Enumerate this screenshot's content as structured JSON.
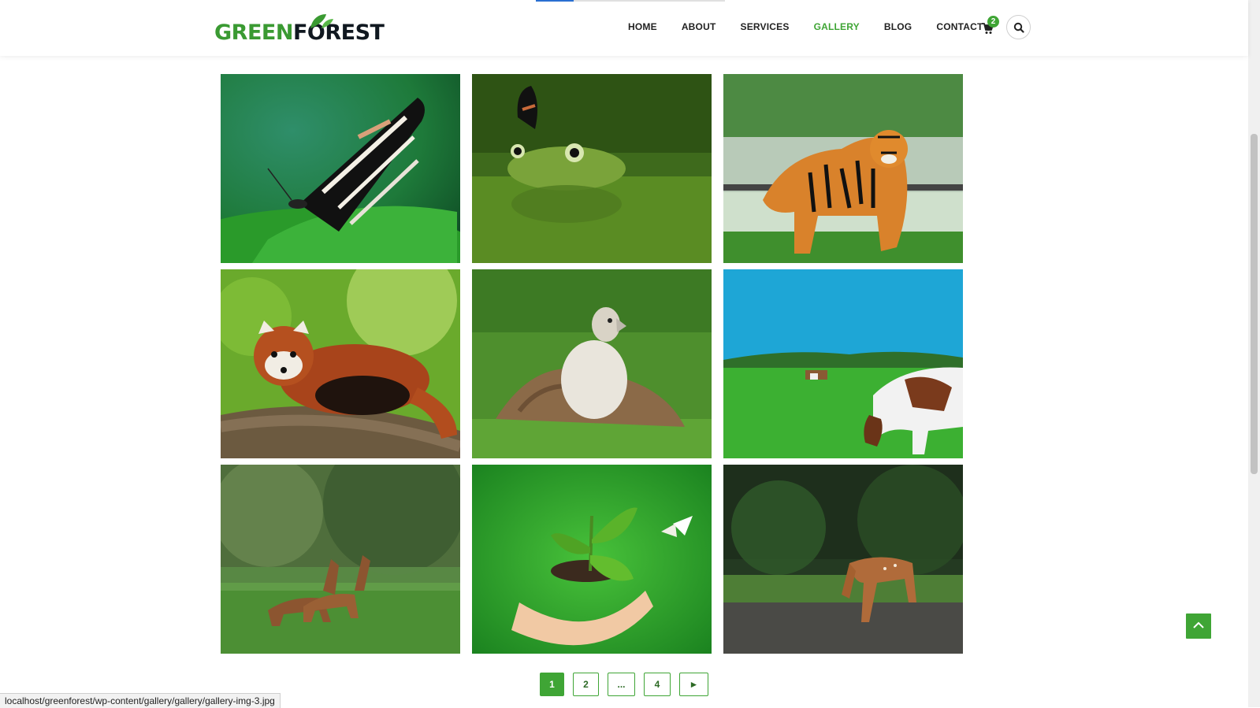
{
  "brand": {
    "logo_part1": "GREEN",
    "logo_part2": "FOREST"
  },
  "nav": {
    "items": [
      {
        "label": "HOME"
      },
      {
        "label": "ABOUT"
      },
      {
        "label": "SERVICES"
      },
      {
        "label": "GALLERY",
        "active": true
      },
      {
        "label": "BLOG"
      },
      {
        "label": "CONTACT"
      }
    ]
  },
  "cart": {
    "count": "2",
    "icon": "cart-icon"
  },
  "search": {
    "icon": "search-icon"
  },
  "gallery": {
    "images": [
      {
        "subject": "butterfly"
      },
      {
        "subject": "frog"
      },
      {
        "subject": "tiger"
      },
      {
        "subject": "red-panda"
      },
      {
        "subject": "vulture"
      },
      {
        "subject": "cows"
      },
      {
        "subject": "deer-pair"
      },
      {
        "subject": "seedling-hand"
      },
      {
        "subject": "fawn"
      }
    ]
  },
  "pagination": {
    "pages": [
      "1",
      "2",
      "...",
      "4"
    ],
    "current": "1",
    "next_label": "►"
  },
  "back_to_top": {
    "icon": "chevron-up-icon"
  },
  "status_bar": {
    "url": "localhost/greenforest/wp-content/gallery/gallery/gallery-img-3.jpg"
  },
  "colors": {
    "accent": "#3fa535",
    "text": "#222222"
  }
}
